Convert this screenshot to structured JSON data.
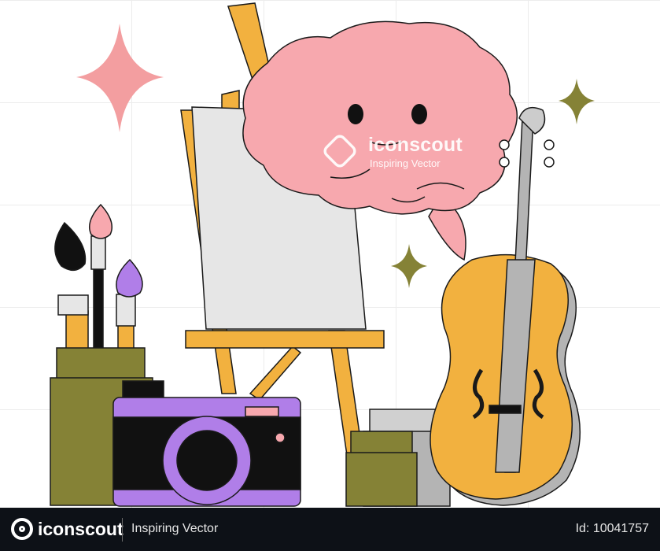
{
  "watermark": {
    "brand": "iconscout",
    "tagline": "Inspiring Vector",
    "icon": "iconscout-logo-icon"
  },
  "footer": {
    "brand": "iconscout",
    "tagline": "Inspiring Vector",
    "asset_id": "Id: 10041757",
    "icon": "iconscout-logo-icon"
  },
  "colors": {
    "brain": "#f7a8ae",
    "easel": "#f2b13f",
    "olive": "#858236",
    "camera": "#b07ee8",
    "violin": "#f2b13f",
    "footer_bg": "#0d1117"
  }
}
